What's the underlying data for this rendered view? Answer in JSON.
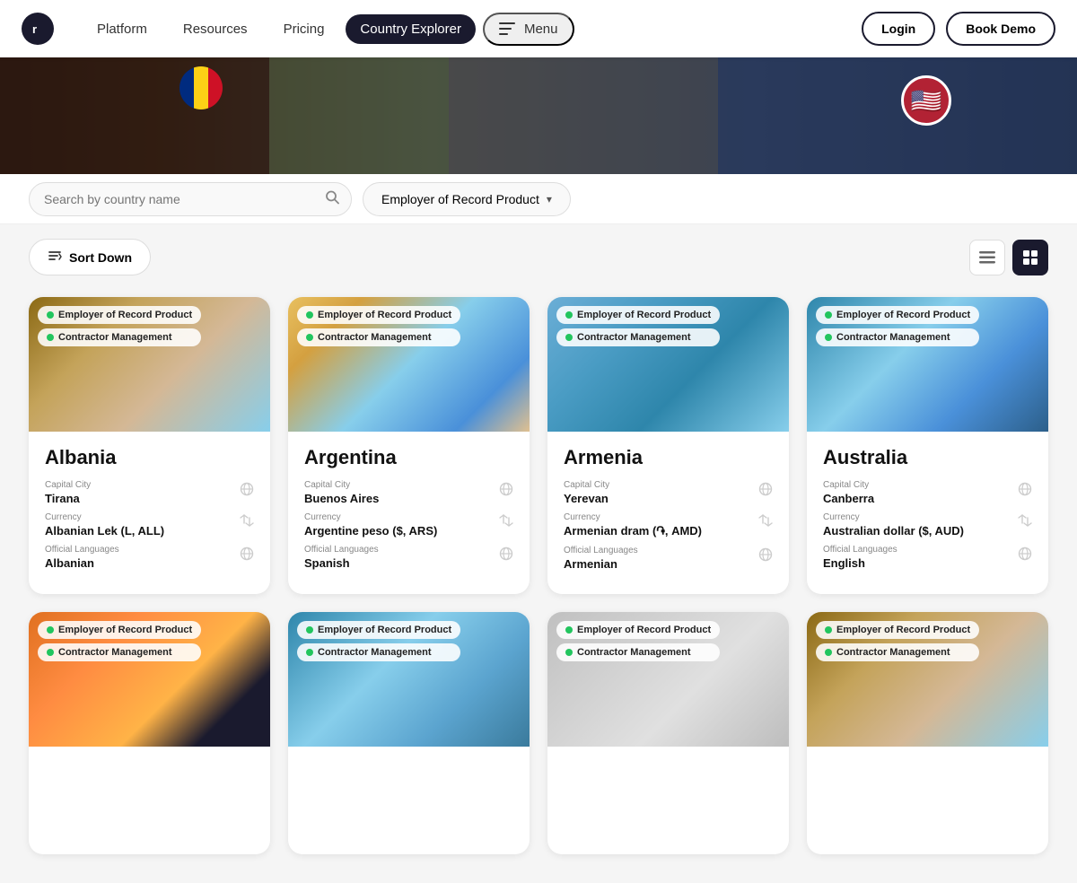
{
  "navbar": {
    "logo_letter": "r",
    "links": [
      {
        "label": "Platform",
        "active": false
      },
      {
        "label": "Resources",
        "active": false
      },
      {
        "label": "Pricing",
        "active": false
      },
      {
        "label": "Country Explorer",
        "active": true
      },
      {
        "label": "Menu",
        "active": false,
        "has_icon": true
      }
    ],
    "login_label": "Login",
    "demo_label": "Book Demo"
  },
  "controls": {
    "search_placeholder": "Search by country name",
    "dropdown_label": "Employer of Record Product",
    "dropdown_arrow": "▾"
  },
  "toolbar": {
    "sort_label": "Sort Down",
    "view_list_title": "List view",
    "view_grid_title": "Grid view"
  },
  "countries": [
    {
      "name": "Albania",
      "badges": [
        "Employer of Record Product",
        "Contractor Management"
      ],
      "capital_label": "Capital City",
      "capital": "Tirana",
      "currency_label": "Currency",
      "currency": "Albanian Lek (L, ALL)",
      "lang_label": "Official Languages",
      "language": "Albanian",
      "img_class": "img-albania"
    },
    {
      "name": "Argentina",
      "badges": [
        "Employer of Record Product",
        "Contractor Management"
      ],
      "capital_label": "Capital City",
      "capital": "Buenos Aires",
      "currency_label": "Currency",
      "currency": "Argentine peso ($, ARS)",
      "lang_label": "Official Languages",
      "language": "Spanish",
      "img_class": "img-argentina"
    },
    {
      "name": "Armenia",
      "badges": [
        "Employer of Record Product",
        "Contractor Management"
      ],
      "capital_label": "Capital City",
      "capital": "Yerevan",
      "currency_label": "Currency",
      "currency": "Armenian dram (֏, AMD)",
      "lang_label": "Official Languages",
      "language": "Armenian",
      "img_class": "img-armenia"
    },
    {
      "name": "Australia",
      "badges": [
        "Employer of Record Product",
        "Contractor Management"
      ],
      "capital_label": "Capital City",
      "capital": "Canberra",
      "currency_label": "Currency",
      "currency": "Australian dollar ($, AUD)",
      "lang_label": "Official Languages",
      "language": "English",
      "img_class": "img-australia"
    },
    {
      "name": "",
      "badges": [
        "Employer of Record Product",
        "Contractor Management"
      ],
      "capital_label": "",
      "capital": "",
      "currency_label": "",
      "currency": "",
      "lang_label": "",
      "language": "",
      "img_class": "img-country5"
    },
    {
      "name": "",
      "badges": [
        "Employer of Record Product",
        "Contractor Management"
      ],
      "capital_label": "",
      "capital": "",
      "currency_label": "",
      "currency": "",
      "lang_label": "",
      "language": "",
      "img_class": "img-country6"
    },
    {
      "name": "",
      "badges": [
        "Employer of Record Product",
        "Contractor Management"
      ],
      "capital_label": "",
      "capital": "",
      "currency_label": "",
      "currency": "",
      "lang_label": "",
      "language": "",
      "img_class": "img-country7"
    },
    {
      "name": "",
      "badges": [
        "Employer of Record Product",
        "Contractor Management"
      ],
      "capital_label": "",
      "capital": "",
      "currency_label": "",
      "currency": "",
      "lang_label": "",
      "language": "",
      "img_class": "img-country8"
    }
  ],
  "icons": {
    "globe": "🌐",
    "exchange": "⇄",
    "search": "🔍",
    "sort": "↕",
    "list": "≡",
    "grid": "⊞"
  }
}
